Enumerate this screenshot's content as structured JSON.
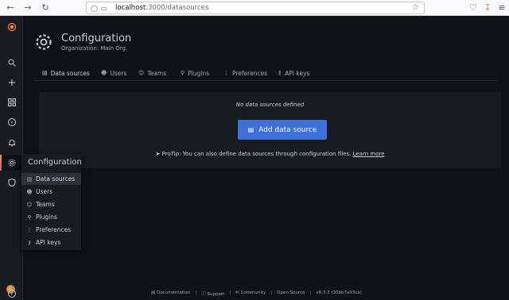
{
  "browser": {
    "url_host": "localhost",
    "url_path": ":3000/datasources"
  },
  "sidemenu": {
    "items": [
      "search",
      "create",
      "dashboards",
      "explore",
      "alerting",
      "configuration",
      "server-admin"
    ]
  },
  "header": {
    "title": "Configuration",
    "subtitle": "Organization: Main Org."
  },
  "tabs": [
    {
      "label": "Data sources",
      "icon": "database-icon"
    },
    {
      "label": "Users",
      "icon": "user-icon"
    },
    {
      "label": "Teams",
      "icon": "users-icon"
    },
    {
      "label": "Plugins",
      "icon": "plug-icon"
    },
    {
      "label": "Preferences",
      "icon": "sliders-icon"
    },
    {
      "label": "API keys",
      "icon": "key-icon"
    }
  ],
  "dropdown": {
    "title": "Configuration",
    "items": [
      {
        "label": "Data sources"
      },
      {
        "label": "Users"
      },
      {
        "label": "Teams"
      },
      {
        "label": "Plugins"
      },
      {
        "label": "Preferences"
      },
      {
        "label": "API keys"
      }
    ]
  },
  "empty_state": {
    "message": "No data sources defined",
    "button": "Add data source",
    "protip": "ProTip: You can also define data sources through configuration files.",
    "learn_more": "Learn more"
  },
  "footer": {
    "documentation": "Documentation",
    "support": "Support",
    "community": "Community",
    "open_source": "Open Source",
    "version": "v8.3.3 (30bb7a93ca)"
  },
  "colors": {
    "accent": "#f55f3e",
    "primary_button": "#3d71d9",
    "background": "#111217",
    "panel": "#181b1f"
  }
}
